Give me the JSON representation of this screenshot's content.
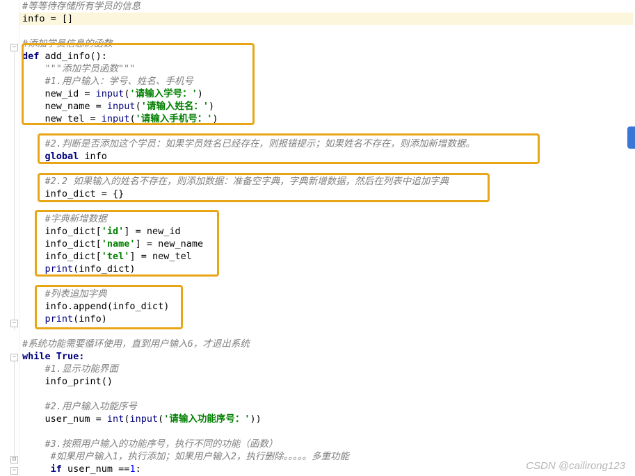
{
  "lines": {
    "c1": "#等等待存储所有学员的信息",
    "l1": "info = []",
    "c2": "#添加学员信息的函数",
    "l2_def": "def",
    "l2_name": " add_info():",
    "l3": "    \"\"\"添加学员函数\"\"\"",
    "c3": "    #1.用户输入：学号、姓名、手机号",
    "l4a": "    new_id = ",
    "l4b": "input",
    "l4c": "(",
    "l4s": "'请输入学号：'",
    "l4d": ")",
    "l5a": "    new_name = ",
    "l5b": "input",
    "l5c": "(",
    "l5s": "'请输入姓名：'",
    "l5d": ")",
    "l6a": "    new_tel = ",
    "l6b": "input",
    "l6c": "(",
    "l6s": "'请输入手机号：'",
    "l6d": ")",
    "c4": "    #2.判断是否添加这个学员：如果学员姓名已经存在，则报错提示；如果姓名不存在，则添加新增数据。",
    "l7a": "    ",
    "l7b": "global",
    "l7c": " info",
    "c5": "    #2.2 如果输入的姓名不存在，则添加数据：准备空字典，字典新增数据，然后在列表中追加字典",
    "l8": "    info_dict = {}",
    "c6": "    #字典新增数据",
    "l9a": "    info_dict[",
    "l9s": "'id'",
    "l9b": "] = new_id",
    "l10a": "    info_dict[",
    "l10s": "'name'",
    "l10b": "] = new_name",
    "l11a": "    info_dict[",
    "l11s": "'tel'",
    "l11b": "] = new_tel",
    "l12a": "    ",
    "l12b": "print",
    "l12c": "(info_dict)",
    "c7": "    #列表追加字典",
    "l13": "    info.append(info_dict)",
    "l14a": "    ",
    "l14b": "print",
    "l14c": "(info)",
    "c8": "#系统功能需要循环使用，直到用户输入6，才退出系统",
    "l15a": "while",
    "l15b": " True:",
    "c9": "    #1.显示功能界面",
    "l16": "    info_print()",
    "c10": "    #2.用户输入功能序号",
    "l17a": "    user_num = ",
    "l17b": "int",
    "l17c": "(",
    "l17d": "input",
    "l17e": "(",
    "l17s": "'请输入功能序号：'",
    "l17f": "))",
    "c11": "    #3.按照用户输入的功能序号，执行不同的功能（函数）",
    "c12": "     #如果用户输入1，执行添加；如果用户输入2，执行删除。。。。。多重功能",
    "l18a": "     ",
    "l18b": "if",
    "l18c": " user_num ==",
    "l18n": "1",
    "l18d": ":"
  },
  "watermark": "CSDN @cailirong123"
}
